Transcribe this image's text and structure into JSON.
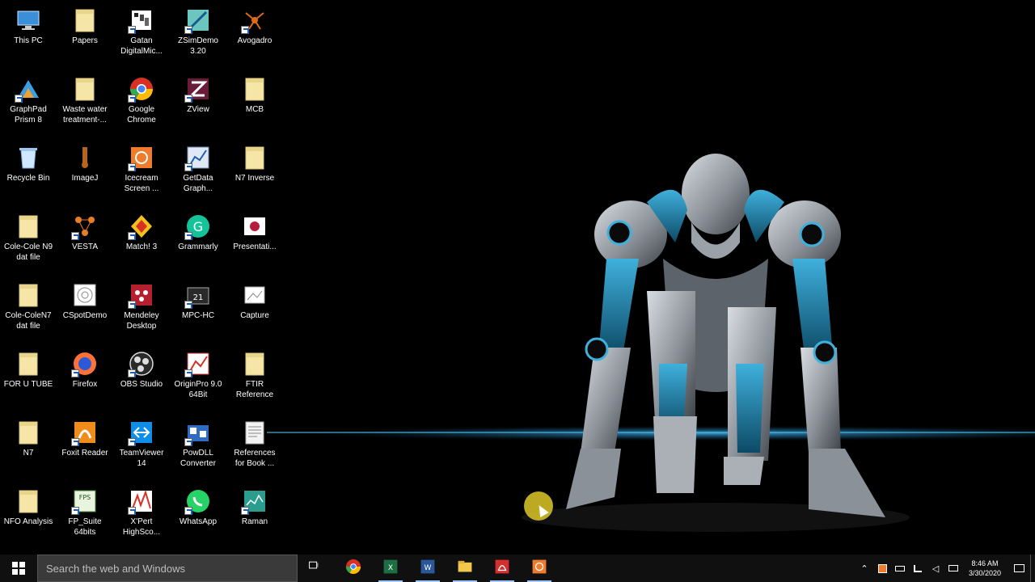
{
  "desktop": {
    "icons": [
      {
        "label": "This PC",
        "icon": "this-pc-icon",
        "shortcut": false
      },
      {
        "label": "Papers",
        "icon": "folder-icon",
        "shortcut": false
      },
      {
        "label": "Gatan\nDigitalMic...",
        "icon": "gatan-app-icon",
        "shortcut": true
      },
      {
        "label": "ZSimDemo\n3.20",
        "icon": "zsimdemo-icon",
        "shortcut": true
      },
      {
        "label": "Avogadro",
        "icon": "avogadro-icon",
        "shortcut": true
      },
      {
        "label": "GraphPad\nPrism 8",
        "icon": "graphpad-icon",
        "shortcut": true
      },
      {
        "label": "Waste water\ntreatment-...",
        "icon": "folder-icon",
        "shortcut": false
      },
      {
        "label": "Google\nChrome",
        "icon": "chrome-icon",
        "shortcut": true
      },
      {
        "label": "ZView",
        "icon": "zview-icon",
        "shortcut": true
      },
      {
        "label": "MCB",
        "icon": "folder-icon",
        "shortcut": false
      },
      {
        "label": "Recycle Bin",
        "icon": "recycle-bin-icon",
        "shortcut": false
      },
      {
        "label": "ImageJ",
        "icon": "imagej-icon",
        "shortcut": false
      },
      {
        "label": "Icecream\nScreen ...",
        "icon": "icecream-icon",
        "shortcut": true
      },
      {
        "label": "GetData\nGraph...",
        "icon": "getdata-icon",
        "shortcut": true
      },
      {
        "label": "N7 Inverse",
        "icon": "folder-icon",
        "shortcut": false
      },
      {
        "label": "Cole-Cole N9\ndat file",
        "icon": "folder-icon",
        "shortcut": false
      },
      {
        "label": "VESTA",
        "icon": "vesta-icon",
        "shortcut": true
      },
      {
        "label": "Match! 3",
        "icon": "match-icon",
        "shortcut": true
      },
      {
        "label": "Grammarly",
        "icon": "grammarly-icon",
        "shortcut": true
      },
      {
        "label": "Presentati...",
        "icon": "presentation-icon",
        "shortcut": false
      },
      {
        "label": "Cole-ColeN7\ndat file",
        "icon": "folder-icon",
        "shortcut": false
      },
      {
        "label": "CSpotDemo",
        "icon": "cspot-icon",
        "shortcut": false
      },
      {
        "label": "Mendeley\nDesktop",
        "icon": "mendeley-icon",
        "shortcut": true
      },
      {
        "label": "MPC-HC",
        "icon": "mpc-hc-icon",
        "shortcut": true
      },
      {
        "label": "Capture",
        "icon": "image-file-icon",
        "shortcut": false
      },
      {
        "label": "FOR U TUBE",
        "icon": "folder-icon",
        "shortcut": false
      },
      {
        "label": "Firefox",
        "icon": "firefox-icon",
        "shortcut": true
      },
      {
        "label": "OBS Studio",
        "icon": "obs-icon",
        "shortcut": true
      },
      {
        "label": "OriginPro 9.0\n64Bit",
        "icon": "origin-icon",
        "shortcut": true
      },
      {
        "label": "FTIR\nReference",
        "icon": "folder-icon",
        "shortcut": false
      },
      {
        "label": "N7",
        "icon": "folder-icon",
        "shortcut": false
      },
      {
        "label": "Foxit Reader",
        "icon": "foxit-icon",
        "shortcut": true
      },
      {
        "label": "TeamViewer\n14",
        "icon": "teamviewer-icon",
        "shortcut": true
      },
      {
        "label": "PowDLL\nConverter",
        "icon": "powdll-icon",
        "shortcut": true
      },
      {
        "label": "References\nfor Book ...",
        "icon": "document-icon",
        "shortcut": false
      },
      {
        "label": "NFO Analysis",
        "icon": "folder-icon",
        "shortcut": false
      },
      {
        "label": "FP_Suite\n64bits",
        "icon": "fpsuite-icon",
        "shortcut": true
      },
      {
        "label": "X'Pert\nHighSco...",
        "icon": "xpert-icon",
        "shortcut": true
      },
      {
        "label": "WhatsApp",
        "icon": "whatsapp-icon",
        "shortcut": true
      },
      {
        "label": "Raman",
        "icon": "raman-icon",
        "shortcut": true
      }
    ]
  },
  "taskbar": {
    "search_placeholder": "Search the web and Windows",
    "pinned": [
      {
        "name": "task-view-icon"
      },
      {
        "name": "chrome-icon"
      },
      {
        "name": "excel-icon"
      },
      {
        "name": "word-icon"
      },
      {
        "name": "file-explorer-icon"
      },
      {
        "name": "acrobat-icon"
      },
      {
        "name": "icecream-icon"
      }
    ],
    "clock": {
      "time": "8:46 AM",
      "date": "3/30/2020"
    }
  },
  "colors": {
    "taskbar_bg": "#101010",
    "search_bg": "#3a3a3a",
    "wallpaper_glow": "#3aa8e0"
  }
}
